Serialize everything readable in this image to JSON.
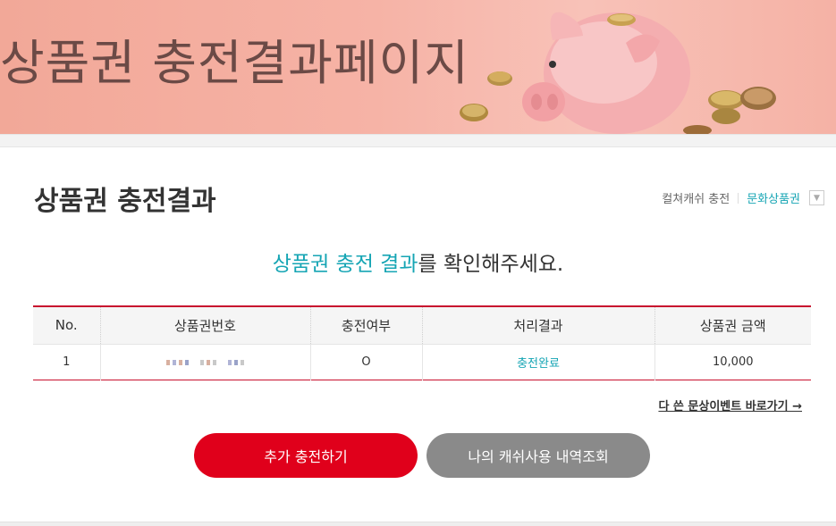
{
  "banner": {
    "title": "상품권 충전결과페이지",
    "art_icon": "piggy-bank-with-coins"
  },
  "section": {
    "title": "상품권 충전결과",
    "tabs": [
      {
        "label": "컬쳐캐쉬 충전",
        "active": false
      },
      {
        "label": "문화상품권",
        "active": true
      }
    ],
    "dropdown_icon": "chevron-down-icon"
  },
  "message": {
    "highlight": "상품권 충전 결과",
    "rest": "를 확인해주세요."
  },
  "table": {
    "headers": [
      "No.",
      "상품권번호",
      "충전여부",
      "처리결과",
      "상품권 금액"
    ],
    "rows": [
      {
        "no": "1",
        "voucher": "",
        "charged": "O",
        "result": "충전완료",
        "amount": "10,000"
      }
    ]
  },
  "event_link": "다 쓴 문상이벤트 바로가기 →",
  "buttons": {
    "primary": "추가 충전하기",
    "secondary": "나의 캐쉬사용 내역조회"
  },
  "colors": {
    "accent_teal": "#16a5b4",
    "brand_red": "#e0001b",
    "table_border": "#c8102e",
    "secondary_gray": "#8a8a8a",
    "banner_pink": "#f6b3a6"
  }
}
